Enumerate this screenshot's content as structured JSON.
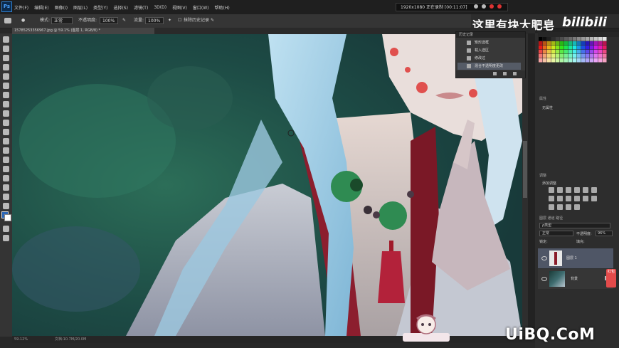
{
  "app": {
    "logo": "Ps"
  },
  "menu": [
    "文件(F)",
    "编辑(E)",
    "图像(I)",
    "图层(L)",
    "类型(Y)",
    "选择(S)",
    "滤镜(T)",
    "3D(D)",
    "视图(V)",
    "窗口(W)",
    "帮助(H)"
  ],
  "menubar": {
    "resolution": "1920x1080  正在录制 [00:11:07]"
  },
  "options": {
    "mode_label": "模式:",
    "mode_value": "正常",
    "opacity_label": "不透明度:",
    "opacity_value": "100%",
    "flow_label": "流量:",
    "flow_value": "100%",
    "airbrush_label": "抹除历史记录"
  },
  "document_tab": "15785253356967.jpg @ 59.1% (图层 1, RGB/8) *",
  "status": {
    "zoom": "59.12%",
    "doc": "文档:10.7M/20.0M"
  },
  "watermark": {
    "text": "这里有块大肥皂",
    "bili": "bilibili"
  },
  "history": {
    "title": "历史记录",
    "items": [
      {
        "label": "矩形选框",
        "icon": "marquee-icon",
        "selected": false
      },
      {
        "label": "载入选区",
        "icon": "brush-icon",
        "selected": false
      },
      {
        "label": "修改过",
        "icon": "brush-icon",
        "selected": false
      },
      {
        "label": "混合不透明度更改",
        "icon": "layer-icon",
        "selected": true
      }
    ]
  },
  "properties": {
    "title": "属性",
    "text": "无属性"
  },
  "adjustments": {
    "title": "调整",
    "subtitle": "添加调整"
  },
  "layers": {
    "tabs": "图层  通道  路径",
    "filter": "ρ类型",
    "blend": "正常",
    "opacity_label": "不透明度:",
    "opacity_value": "96%",
    "lock_label": "锁定:",
    "fill_label": "填充:",
    "items": [
      {
        "name": "图层 1",
        "selected": true
      },
      {
        "name": "背景",
        "selected": false
      }
    ]
  },
  "badge": "红包",
  "site_watermark": "UiBQ.CoM",
  "colors": {
    "accent": "#2f7cc9",
    "selection": "#4f5666",
    "badge": "#e34b4b"
  }
}
